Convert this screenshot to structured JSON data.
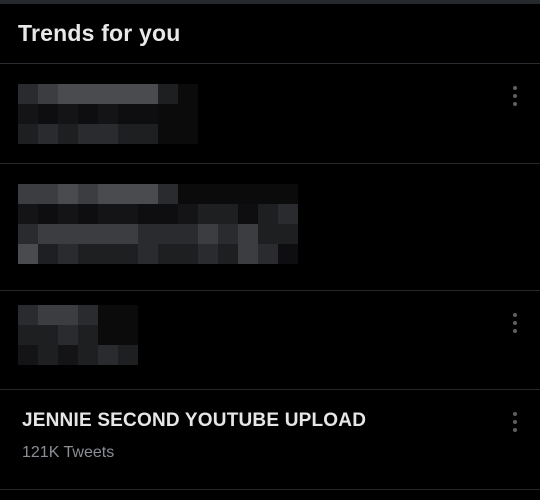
{
  "header": {
    "title": "Trends for you"
  },
  "trends": [
    {
      "redacted": true,
      "more_icon": "more-vertical-icon"
    },
    {
      "redacted": true
    },
    {
      "redacted": true,
      "more_icon": "more-vertical-icon"
    },
    {
      "redacted": false,
      "name": "JENNIE SECOND YOUTUBE UPLOAD",
      "count": "121K Tweets",
      "more_icon": "more-vertical-icon"
    }
  ]
}
